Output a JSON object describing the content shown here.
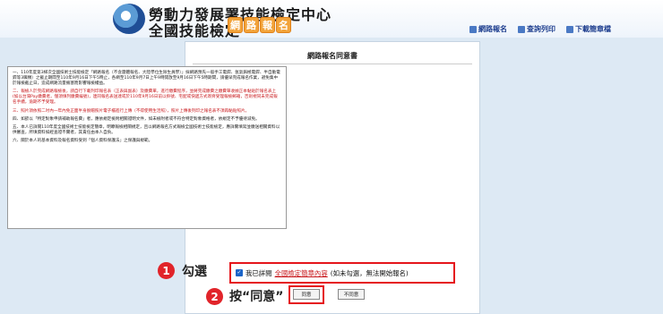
{
  "header": {
    "org_title": "勞動力發展署技能檢定中心",
    "site_title": "全國技能檢定",
    "badge_chars": [
      "網",
      "路",
      "報",
      "名"
    ],
    "links": [
      {
        "label": "網路報名",
        "icon": "register-icon"
      },
      {
        "label": "查詢列印",
        "icon": "print-icon"
      },
      {
        "label": "下載簡章檔",
        "icon": "download-icon"
      }
    ]
  },
  "panel": {
    "title": "網路報名同意書",
    "doc": {
      "p1": "一、110年度第3梯次全國技術士技能檢定「網路報名（不含團體報名、大陸學位生除生員學）」採網路預先一般手工電銲、氬氣鎢極電銲、半自動電銲等3職類）之截止期間至110年9月16日下午5時止，各網至110年9月7日上午9時開放至9月16日下午5時期間，請優早完成報名作業，避免集中於報檢截止日，造成網路流量擁塞而影響報檢權益。",
      "p2": "二、報檢人於完成網路報檢後，請自行下載列印報名表（正表與副表）及繳費單，進行繳費程序，並將完成繳費之繳費單收據正本黏貼於報名表上(如以台灣Pay繳費者，僅須填列繳費編號)，連同報名表送達或於110年9月16日前以掛號、宅配或快遞方式寄齊受理報檢郵箱，否則視同未完成報名手續，逾期不予受理。",
      "p3": "三、照片須依照二吋內一年內免正面半身脫帽照片電子檔進行上傳（不得使用生活照），照片上傳後列印之報名表不須再黏貼照片。",
      "p4": "四、如欲以「特定對象申請補助報名費」者，應依規定檢附相關證明文件，如未檢附者或不符合特定對象資格者，依規定不予優待減免。",
      "p5": "五、本人已詳閱110年度全國技術士技能檢定簡章，明瞭報檢相關規定，且以網路報名方式報檢全國技術士技能檢定，應詳實填寫並繳送相關資料以供審查，所填資料如經查證不實者，其責任由本人自負。",
      "p6": "六、關於本人的基本資料及報名資料受到「個人資料保護法」之保護與規範。"
    }
  },
  "consent": {
    "prefix": "我已詳閱",
    "link": "全國檢定簡章內容",
    "suffix": "(如未勾選，無法開始報名)",
    "checked": true
  },
  "annotations": {
    "step1_num": "1",
    "step1_text": "勾選",
    "step2_num": "2",
    "step2_text": "按“同意”"
  },
  "buttons": {
    "agree": "同意",
    "disagree": "不同意"
  },
  "colors": {
    "accent_red": "#e5151b",
    "link_blue": "#1f3f8f",
    "badge_orange": "#f2a33a"
  }
}
